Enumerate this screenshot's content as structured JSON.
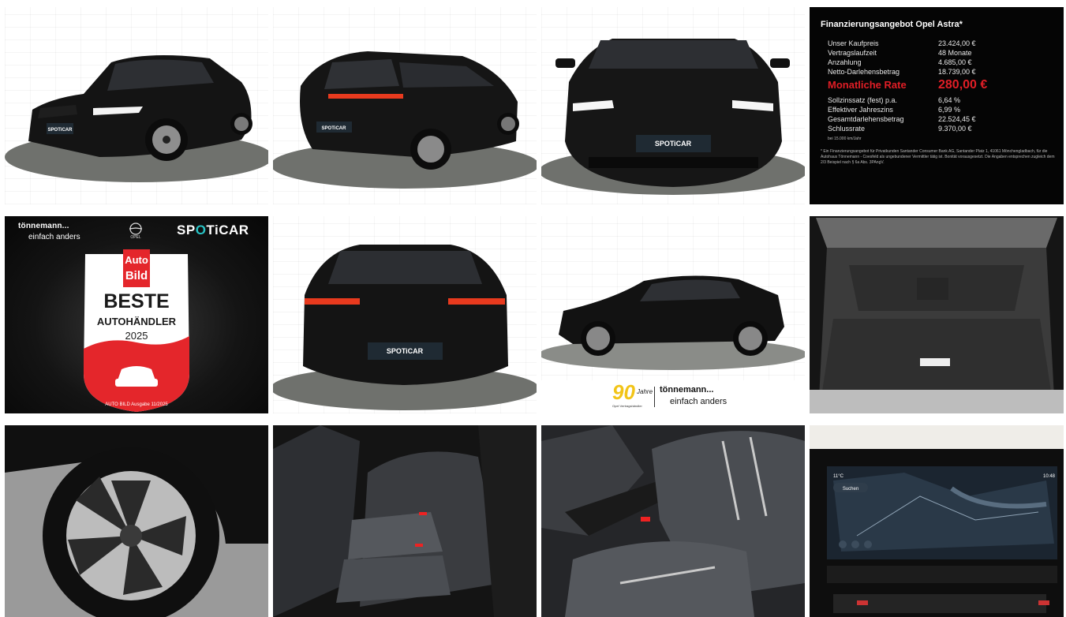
{
  "gallery": {
    "tiles": [
      {
        "id": 1,
        "description_icon": "car-front-left-photo"
      },
      {
        "id": 2,
        "description_icon": "car-rear-right-photo"
      },
      {
        "id": 3,
        "description_icon": "car-front-photo"
      },
      {
        "id": 4,
        "description_icon": "finance-offer-image"
      },
      {
        "id": 5,
        "description_icon": "award-image"
      },
      {
        "id": 6,
        "description_icon": "car-rear-photo"
      },
      {
        "id": 7,
        "description_icon": "car-side-photo"
      },
      {
        "id": 8,
        "description_icon": "trunk-photo"
      },
      {
        "id": 9,
        "description_icon": "wheel-photo"
      },
      {
        "id": 10,
        "description_icon": "rear-seats-photo"
      },
      {
        "id": 11,
        "description_icon": "front-seat-photo"
      },
      {
        "id": 12,
        "description_icon": "infotainment-photo"
      }
    ]
  },
  "finance": {
    "title": "Finanzierungsangebot Opel Astra*",
    "rows_top": [
      {
        "label": "Unser Kaufpreis",
        "value": "23.424,00 €"
      },
      {
        "label": "Vertragslaufzeit",
        "value": "48 Monate"
      },
      {
        "label": "Anzahlung",
        "value": "4.685,00 €"
      },
      {
        "label": "Netto-Darlehensbetrag",
        "value": "18.739,00 €"
      }
    ],
    "rate_label": "Monatliche Rate",
    "rate_value": "280,00 €",
    "rows_bottom": [
      {
        "label": "Sollzinssatz (fest) p.a.",
        "value": "6,64 %"
      },
      {
        "label": "Effektiver Jahreszins",
        "value": "6,99 %"
      },
      {
        "label": "Gesamtdarlehensbetrag",
        "value": "22.524,45 €"
      },
      {
        "label": "Schlussrate",
        "value": "9.370,00 €"
      }
    ],
    "km_note": "bei 15.000 km/Jahr",
    "footnote": "* Ein Finanzierungsangebot für Privatkunden Santander Consumer Bank AG, Santander Platz 1, 41061 Mönchengladbach, für die Autohaus Tönnemann - Coesfeld als ungebundener Vermittler tätig ist. Bonität vorausgesetzt. Die Angaben entsprechen zugleich dem 2/3 Beispiel nach § 6a Abs. 3PAngV."
  },
  "award": {
    "dealer_name": "tönnemann...",
    "dealer_tagline": "einfach anders",
    "opel_label": "OPEL",
    "spoticar_a": "SP",
    "spoticar_b": "O",
    "spoticar_c": "TiCAR",
    "badge_brand_1": "Auto",
    "badge_brand_2": "Bild",
    "badge_line1": "BESTE",
    "badge_line2": "AUTOHÄNDLER",
    "badge_year": "2025",
    "badge_source": "AUTO BILD Ausgabe 11/2025"
  },
  "side_caption": {
    "anniversary_number": "90",
    "anniversary_word": "Jahre",
    "anniversary_sub": "Opel Vertragshändler",
    "dealer_name": "tönnemann...",
    "dealer_tagline": "einfach anders"
  },
  "plate_text": "SPOTiCAR",
  "infotainment": {
    "temperature": "11°C",
    "search_label": "Suchen",
    "clock": "10:48"
  },
  "colors": {
    "accent_red": "#e11e26",
    "spoticar_teal": "#29c3c5",
    "anniversary_yellow": "#f2c417"
  }
}
